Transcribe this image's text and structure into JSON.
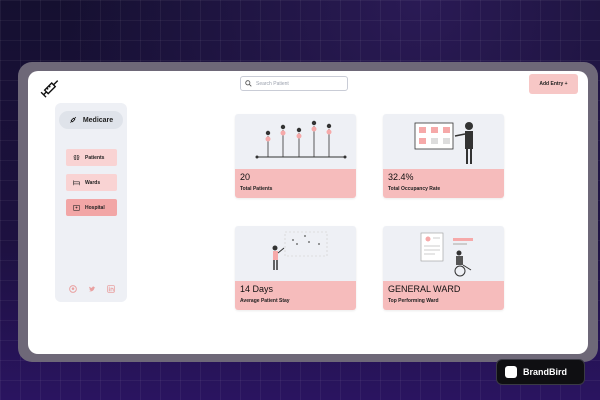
{
  "search": {
    "placeholder": "Search Patient"
  },
  "header": {
    "add_entry_label": "Add Entry +"
  },
  "sidebar": {
    "brand": "Medicare",
    "items": [
      {
        "label": "Patients",
        "icon": "brain-icon"
      },
      {
        "label": "Wards",
        "icon": "bed-icon"
      },
      {
        "label": "Hospital",
        "icon": "hospital-icon",
        "active": true
      }
    ],
    "socials": [
      "github-icon",
      "twitter-icon",
      "linkedin-icon"
    ]
  },
  "cards": [
    {
      "value": "20",
      "label": "Total Patients"
    },
    {
      "value": "32.4%",
      "label": "Total Occupancy Rate"
    },
    {
      "value": "14 Days",
      "label": "Average Patient Stay"
    },
    {
      "value": "GENERAL WARD",
      "label": "Top Performing Ward"
    }
  ],
  "watermark": {
    "label": "BrandBird"
  },
  "colors": {
    "accent_pink": "#f6bcbc",
    "sidebar_bg": "#eef0f5",
    "active_nav": "#f2a6a6"
  }
}
